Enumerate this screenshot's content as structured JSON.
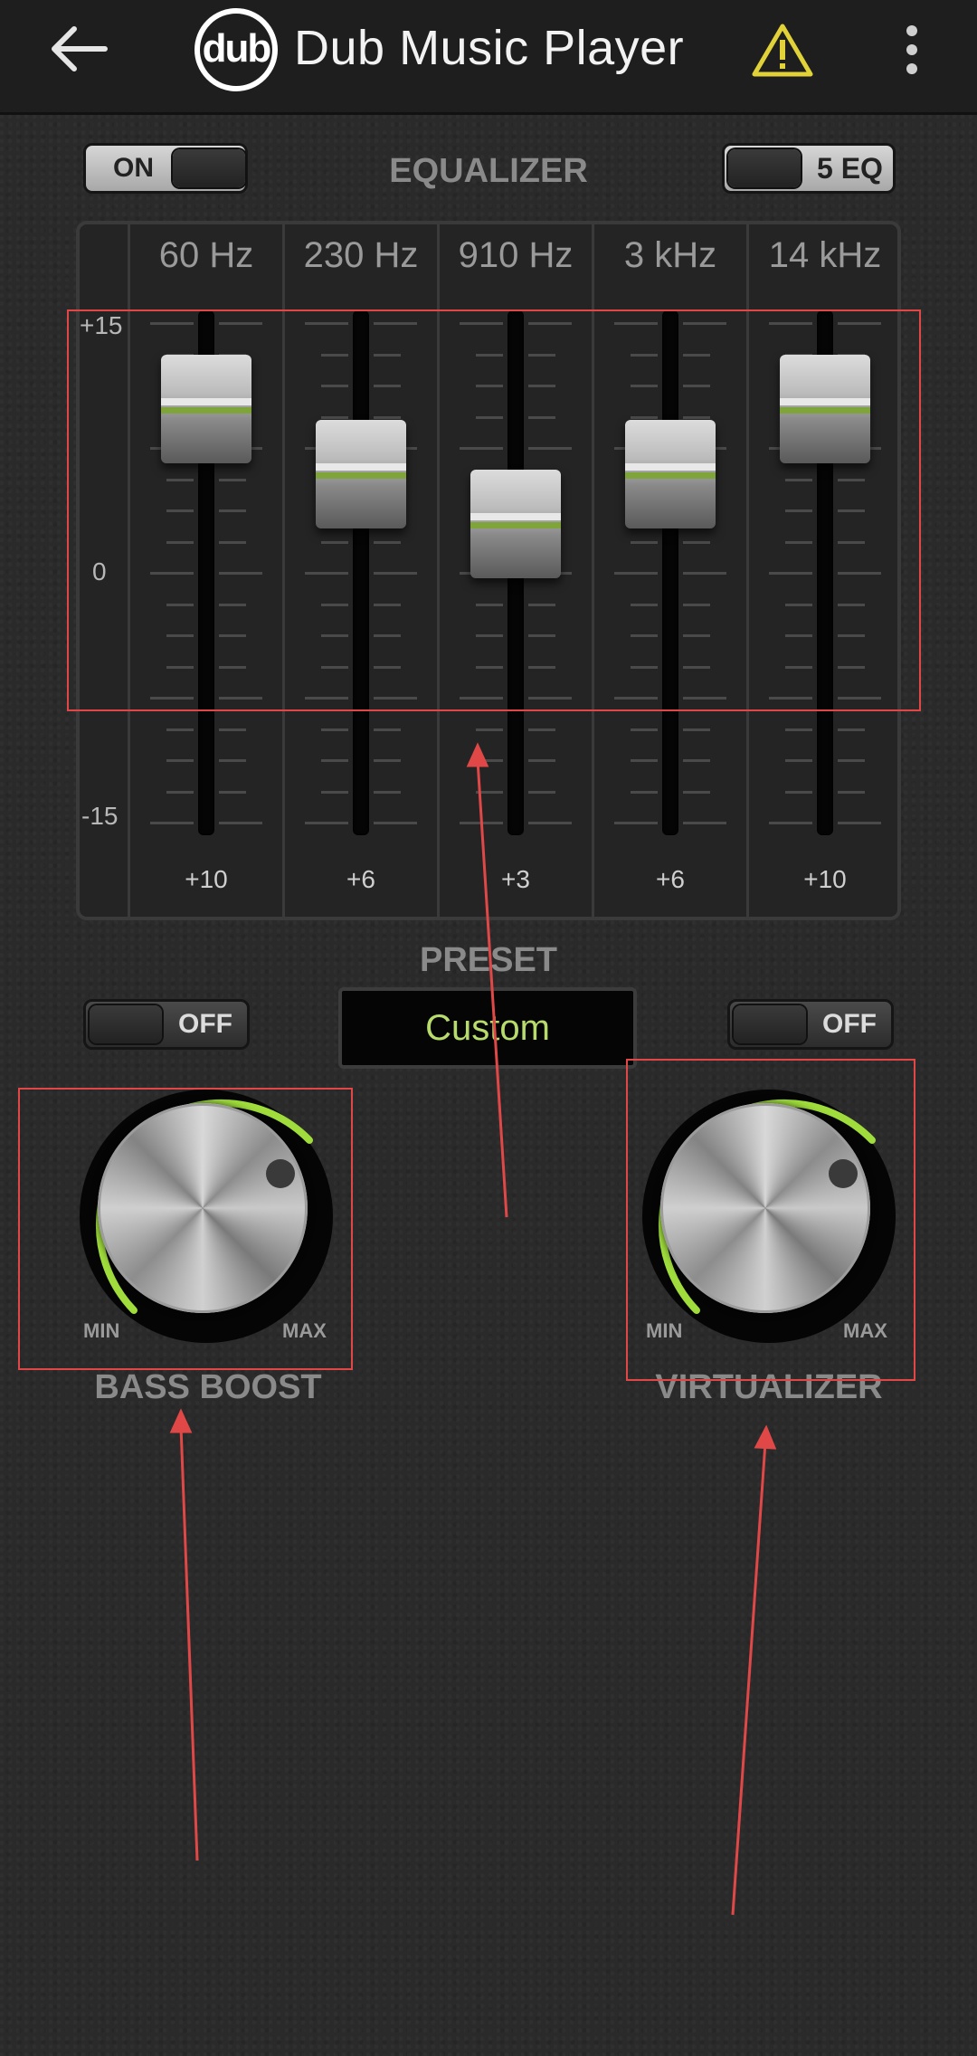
{
  "header": {
    "logo_text": "dub",
    "title": "Dub Music Player",
    "back_icon": "arrow-left-icon",
    "warning_icon": "warning-triangle-icon",
    "more_icon": "more-vertical-icon"
  },
  "equalizer": {
    "title": "EQUALIZER",
    "toggle_label": "ON",
    "mode_label": "5 EQ",
    "db_labels": {
      "top": "+15",
      "mid": "0",
      "bottom": "-15"
    },
    "bands": [
      {
        "freq": "60 Hz",
        "value_label": "+10",
        "value": 10
      },
      {
        "freq": "230 Hz",
        "value_label": "+6",
        "value": 6
      },
      {
        "freq": "910 Hz",
        "value_label": "+3",
        "value": 3
      },
      {
        "freq": "3 kHz",
        "value_label": "+6",
        "value": 6
      },
      {
        "freq": "14 kHz",
        "value_label": "+10",
        "value": 10
      }
    ]
  },
  "preset": {
    "title": "PRESET",
    "value": "Custom"
  },
  "bass_boost": {
    "title": "BASS BOOST",
    "toggle_label": "OFF",
    "min_label": "MIN",
    "max_label": "MAX"
  },
  "virtualizer": {
    "title": "VIRTUALIZER",
    "toggle_label": "OFF",
    "min_label": "MIN",
    "max_label": "MAX"
  },
  "colors": {
    "accent": "#b7dc6c",
    "annotation": "#e04848"
  }
}
